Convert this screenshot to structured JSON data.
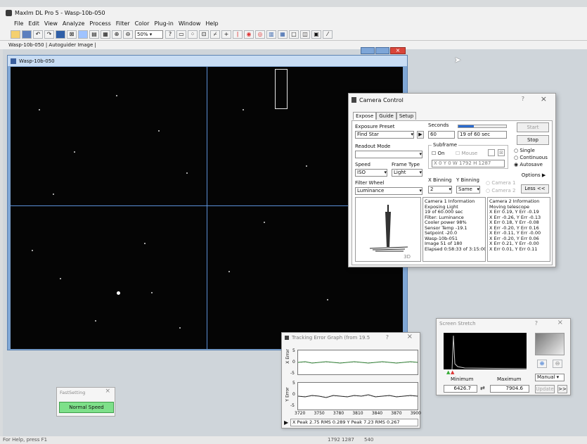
{
  "app": {
    "title": "MaxIm DL Pro 5 - Wasp-10b-050",
    "menu": [
      "File",
      "Edit",
      "View",
      "Analyze",
      "Process",
      "Filter",
      "Color",
      "Plug-in",
      "Window",
      "Help"
    ],
    "zoom": "50%",
    "tab_label": "Wasp-10b-050 | Autoguider Image |"
  },
  "image_window": {
    "title": "Wasp-10b-050"
  },
  "camera_control": {
    "title": "Camera Control",
    "help": "?",
    "tabs": [
      "Expose",
      "Guide",
      "Setup"
    ],
    "exposure_preset_label": "Exposure Preset",
    "exposure_preset_value": "Find Star",
    "seconds_label": "Seconds",
    "seconds_value": "60",
    "progress_text": "19 of 60 sec",
    "progress_fraction": 0.32,
    "start_label": "Start",
    "stop_label": "Stop",
    "readout_label": "Readout Mode",
    "readout_value": "",
    "subframe_label": "Subframe",
    "on_label": "On",
    "mouse_label": "Mouse",
    "subframe_coords": "X 0 Y 0 W 1792 H 1287",
    "speed_label": "Speed",
    "speed_value": "ISO",
    "frame_type_label": "Frame Type",
    "frame_type_value": "Light",
    "single_label": "Single",
    "continuous_label": "Continuous",
    "autosave_label": "Autosave",
    "options_label": "Options",
    "filter_wheel_label": "Filter Wheel",
    "filter_value": "Luminance",
    "xbin_label": "X Binning",
    "xbin_value": "2",
    "ybin_label": "Y Binning",
    "ybin_value": "Same",
    "camera1_label": "Camera 1",
    "camera2_label": "Camera 2",
    "less_label": "Less <<",
    "readout_3d": "3D",
    "cam1_info": [
      "Camera 1 Information",
      "Exposing Light",
      "19 of 60.000 sec",
      "Filter: Luminance",
      "Cooler power 98%",
      "Sensor Temp -19.1",
      "Setpoint -20.0",
      "Wasp-10b-051",
      "Image 51 of 180",
      "Elapsed 0:58:33 of 3:15:00"
    ],
    "cam2_info": [
      "Camera 2 Information",
      "Moving telescope",
      "X Err 0.19, Y Err -0.19",
      "X Err -0.26, Y Err -0.13",
      "X Err 0.18, Y Err -0.08",
      "X Err -0.20, Y Err 0.16",
      "X Err -0.11, Y Err -0.00",
      "X Err -0.20, Y Err 0.06",
      "X Err 0.21, Y Err -0.00",
      "X Err 0.01, Y Err 0.11"
    ]
  },
  "screen_stretch": {
    "title": "Screen Stretch",
    "help": "?",
    "minimum_label": "Minimum",
    "maximum_label": "Maximum",
    "minimum_value": "6426.7",
    "maximum_value": "7904.6",
    "mode_value": "Manual",
    "update_label": "Update",
    "more_label": ">>"
  },
  "tracking": {
    "title": "Tracking Error Graph (from 19.5",
    "help": "?",
    "x_axis_label": "X Error",
    "y_axis_label": "Y Error",
    "y_ticks": [
      "5",
      "0",
      "-5"
    ],
    "x_ticks": [
      "3720",
      "3750",
      "3780",
      "3810",
      "3840",
      "3870",
      "3900"
    ],
    "status": "X Peak 2.75  RMS 0.289   Y Peak 7.23  RMS 0.267"
  },
  "fast_setting": {
    "title": "FastSetting",
    "button_label": "Normal Speed"
  },
  "status_bar": {
    "left": "For Help, press F1",
    "mid": "1792 1287",
    "right": "540"
  },
  "colors": {
    "accent_blue": "#2a6bcf",
    "crosshair": "#5b8fd6",
    "normal_speed_green": "#7ee08a",
    "close_red": "#d9453a"
  }
}
